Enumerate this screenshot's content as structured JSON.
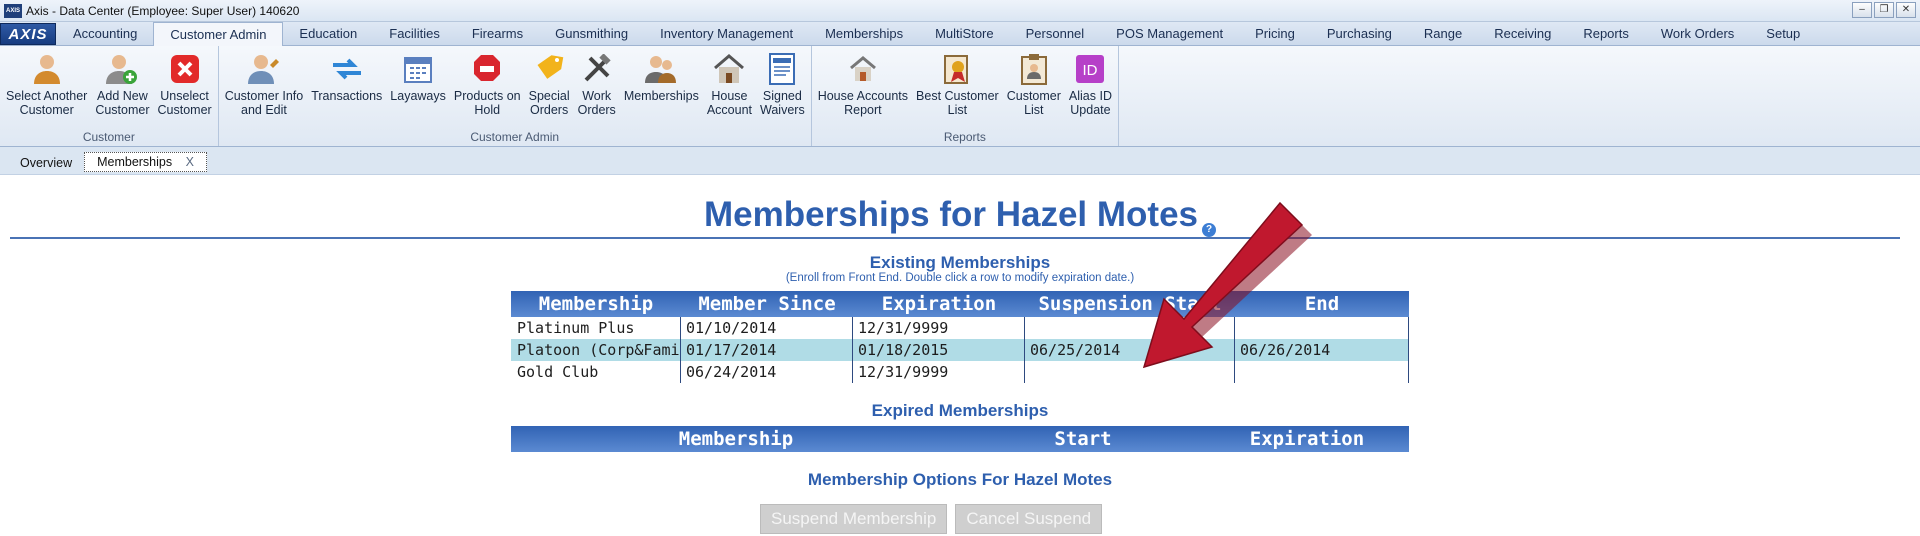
{
  "window": {
    "logo": "AXIS",
    "title": "Axis - Data Center  (Employee: Super User) 140620",
    "controls": [
      "–",
      "❐",
      "✕"
    ]
  },
  "app_button": "AXIS",
  "ribbon_tabs": [
    "Accounting",
    "Customer Admin",
    "Education",
    "Facilities",
    "Firearms",
    "Gunsmithing",
    "Inventory Management",
    "Memberships",
    "MultiStore",
    "Personnel",
    "POS Management",
    "Pricing",
    "Purchasing",
    "Range",
    "Receiving",
    "Reports",
    "Work Orders",
    "Setup"
  ],
  "active_ribbon_tab": "Customer Admin",
  "ribbon_groups": {
    "customer": {
      "name": "Customer",
      "items": [
        {
          "label": "Select Another\nCustomer",
          "icon": "person-icon"
        },
        {
          "label": "Add New\nCustomer",
          "icon": "person-add-icon"
        },
        {
          "label": "Unselect\nCustomer",
          "icon": "close-icon"
        }
      ]
    },
    "customer_admin": {
      "name": "Customer Admin",
      "items": [
        {
          "label": "Customer Info\nand Edit",
          "icon": "person-edit-icon"
        },
        {
          "label": "Transactions",
          "icon": "transfer-arrows-icon"
        },
        {
          "label": "Layaways",
          "icon": "calendar-icon"
        },
        {
          "label": "Products on\nHold",
          "icon": "hold-icon"
        },
        {
          "label": "Special\nOrders",
          "icon": "special-tag-icon"
        },
        {
          "label": "Work\nOrders",
          "icon": "tools-icon"
        },
        {
          "label": "Memberships",
          "icon": "members-icon"
        },
        {
          "label": "House\nAccount",
          "icon": "house-icon"
        },
        {
          "label": "Signed\nWaivers",
          "icon": "waiver-document-icon"
        }
      ]
    },
    "reports": {
      "name": "Reports",
      "items": [
        {
          "label": "House Accounts\nReport",
          "icon": "house-report-icon"
        },
        {
          "label": "Best Customer\nList",
          "icon": "award-list-icon"
        },
        {
          "label": "Customer\nList",
          "icon": "clipboard-list-icon"
        },
        {
          "label": "Alias ID\nUpdate",
          "icon": "id-badge-icon"
        }
      ]
    }
  },
  "doc_tabs": {
    "overview": "Overview",
    "memberships": "Memberships",
    "close": "X"
  },
  "page": {
    "title": "Memberships for Hazel Motes",
    "help": "?",
    "existing_title": "Existing Memberships",
    "existing_note": "(Enroll from Front End. Double click a row to modify expiration date.)",
    "existing_headers": [
      "Membership",
      "Member Since",
      "Expiration",
      "Suspension Start",
      "End"
    ],
    "existing_rows": [
      [
        "Platinum Plus",
        "01/10/2014",
        "12/31/9999",
        "",
        ""
      ],
      [
        "Platoon (Corp&Family)",
        "01/17/2014",
        "01/18/2015",
        "06/25/2014",
        "06/26/2014"
      ],
      [
        "Gold Club",
        "06/24/2014",
        "12/31/9999",
        "",
        ""
      ]
    ],
    "selected_row": 1,
    "expired_title": "Expired Memberships",
    "expired_headers": [
      "Membership",
      "Start",
      "Expiration"
    ],
    "options_title": "Membership Options For   Hazel Motes",
    "suspend_button": "Suspend Membership",
    "cancel_button": "Cancel Suspend"
  },
  "colors": {
    "accent": "#2e5fae",
    "header_bar": "#3163b4",
    "selected_row": "#b0dce6",
    "arrow": "#c0182e"
  }
}
